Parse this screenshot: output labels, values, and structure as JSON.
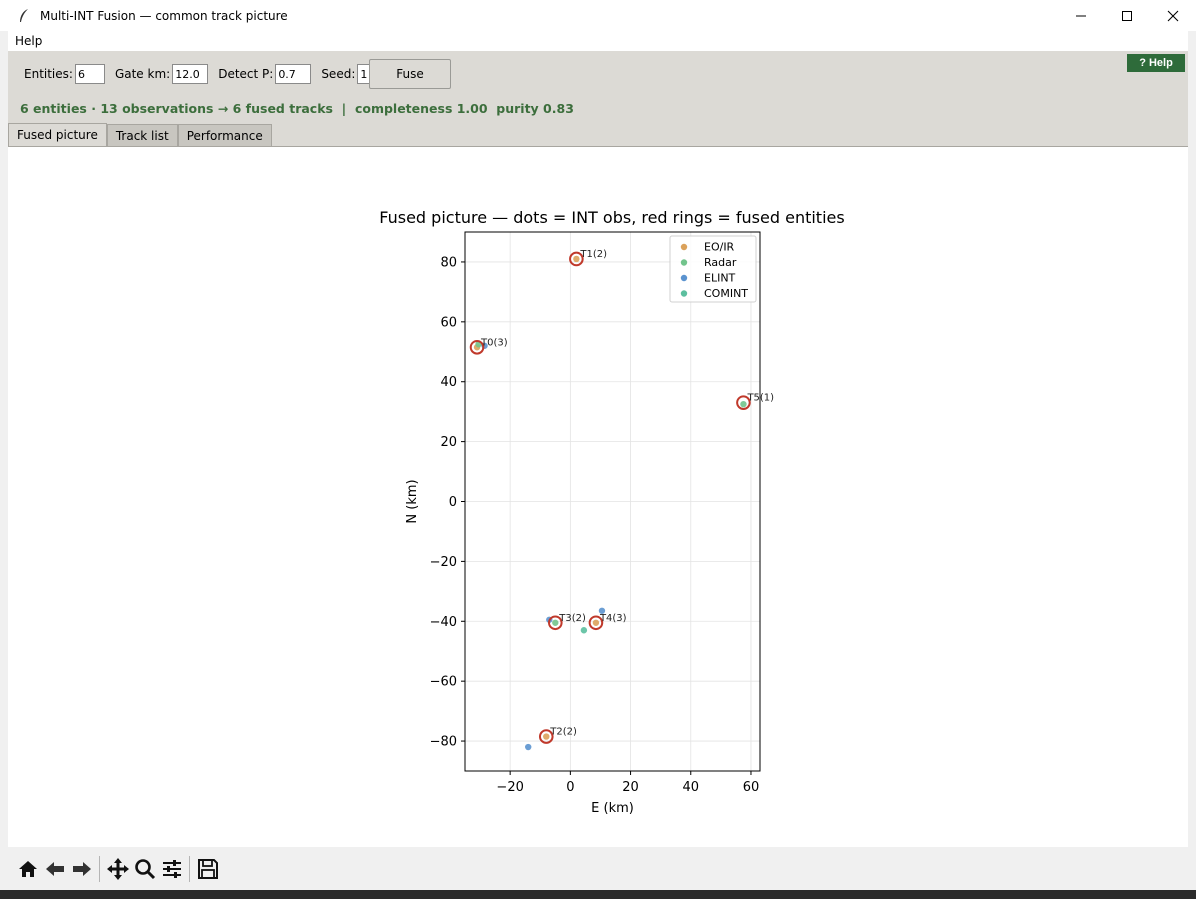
{
  "window": {
    "title": "Multi-INT Fusion — common track picture"
  },
  "menu": {
    "items": [
      "Help"
    ]
  },
  "controls": {
    "entities_label": "Entities:",
    "entities_value": "6",
    "gate_label": "Gate km:",
    "gate_value": "12.0",
    "detect_label": "Detect P:",
    "detect_value": "0.7",
    "seed_label": "Seed:",
    "seed_value": "1",
    "fuse_label": "Fuse",
    "help_label": "? Help"
  },
  "summary": "6 entities · 13 observations → 6 fused tracks  |  completeness 1.00  purity 0.83",
  "tabs": [
    {
      "label": "Fused picture",
      "active": true
    },
    {
      "label": "Track list",
      "active": false
    },
    {
      "label": "Performance",
      "active": false
    }
  ],
  "colors": {
    "eo_ir": "#dba25b",
    "radar": "#72c48c",
    "elint": "#5b93cf",
    "comint": "#5cbf9f",
    "ring": "#c0392b",
    "summary_text": "#3c6e3c",
    "help_bg": "#2e6b3a"
  },
  "chart_data": {
    "type": "scatter",
    "title": "Fused picture — dots = INT obs, red rings = fused entities",
    "xlabel": "E (km)",
    "ylabel": "N (km)",
    "xlim": [
      -35,
      63
    ],
    "ylim": [
      -90,
      90
    ],
    "xticks": [
      -20,
      0,
      20,
      40,
      60
    ],
    "yticks": [
      -80,
      -60,
      -40,
      -20,
      0,
      20,
      40,
      60,
      80
    ],
    "xtick_labels": [
      "−20",
      "0",
      "20",
      "40",
      "60"
    ],
    "ytick_labels": [
      "−80",
      "−60",
      "−40",
      "−20",
      "0",
      "20",
      "40",
      "60",
      "80"
    ],
    "grid": true,
    "legend": "top-right",
    "series": [
      {
        "name": "EO/IR",
        "color": "#dba25b",
        "points": [
          [
            2,
            81
          ],
          [
            -31,
            51.5
          ],
          [
            -8,
            -78.5
          ],
          [
            8.5,
            -40.5
          ]
        ]
      },
      {
        "name": "Radar",
        "color": "#72c48c",
        "points": [
          [
            57.5,
            32.5
          ],
          [
            -30.5,
            52.5
          ],
          [
            -5,
            -40.5
          ]
        ]
      },
      {
        "name": "ELINT",
        "color": "#5b93cf",
        "points": [
          [
            -28.5,
            52
          ],
          [
            -14,
            -82
          ],
          [
            -7,
            -39.5
          ],
          [
            10.5,
            -36.5
          ]
        ]
      },
      {
        "name": "COMINT",
        "color": "#5cbf9f",
        "points": [
          [
            4.5,
            -43
          ]
        ]
      }
    ],
    "fused": [
      {
        "label": "T0(3)",
        "x": -31,
        "y": 51.5
      },
      {
        "label": "T1(2)",
        "x": 2,
        "y": 81
      },
      {
        "label": "T2(2)",
        "x": -8,
        "y": -78.5
      },
      {
        "label": "T3(2)",
        "x": -5,
        "y": -40.5
      },
      {
        "label": "T4(3)",
        "x": 8.5,
        "y": -40.5
      },
      {
        "label": "T5(1)",
        "x": 57.5,
        "y": 33
      }
    ]
  },
  "nav_icons": [
    "home-icon",
    "back-icon",
    "forward-icon",
    "pan-icon",
    "zoom-icon",
    "configure-icon",
    "save-icon"
  ]
}
